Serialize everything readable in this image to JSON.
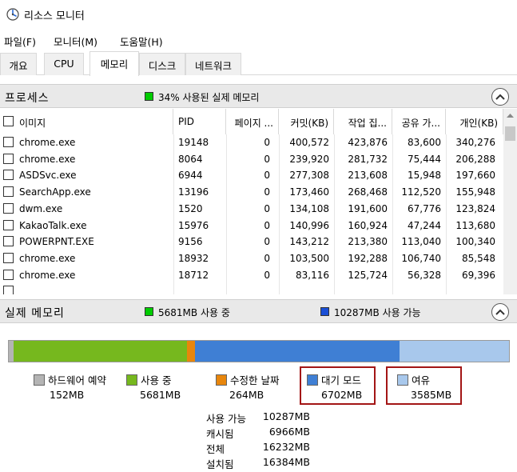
{
  "window": {
    "title": "리소스 모니터"
  },
  "menu": [
    "파일(F)",
    "모니터(M)",
    "도움말(H)"
  ],
  "tabs": [
    "개요",
    "CPU",
    "메모리",
    "디스크",
    "네트워크"
  ],
  "active_tab": "메모리",
  "process_section": {
    "title": "프로세스",
    "summary": "34% 사용된 실제 메모리",
    "summary_color": "#00cc00",
    "columns": [
      "이미지",
      "PID",
      "페이지 ...",
      "커밋(KB)",
      "작업 집...",
      "공유 가...",
      "개인(KB)"
    ],
    "rows": [
      {
        "image": "chrome.exe",
        "pid": "19148",
        "page": "0",
        "commit": "400,572",
        "working": "423,876",
        "shared": "83,600",
        "private": "340,276"
      },
      {
        "image": "chrome.exe",
        "pid": "8064",
        "page": "0",
        "commit": "239,920",
        "working": "281,732",
        "shared": "75,444",
        "private": "206,288"
      },
      {
        "image": "ASDSvc.exe",
        "pid": "6944",
        "page": "0",
        "commit": "277,308",
        "working": "213,608",
        "shared": "15,948",
        "private": "197,660"
      },
      {
        "image": "SearchApp.exe",
        "pid": "13196",
        "page": "0",
        "commit": "173,460",
        "working": "268,468",
        "shared": "112,520",
        "private": "155,948"
      },
      {
        "image": "dwm.exe",
        "pid": "1520",
        "page": "0",
        "commit": "134,108",
        "working": "191,600",
        "shared": "67,776",
        "private": "123,824"
      },
      {
        "image": "KakaoTalk.exe",
        "pid": "15976",
        "page": "0",
        "commit": "140,996",
        "working": "160,924",
        "shared": "47,244",
        "private": "113,680"
      },
      {
        "image": "POWERPNT.EXE",
        "pid": "9156",
        "page": "0",
        "commit": "143,212",
        "working": "213,380",
        "shared": "113,040",
        "private": "100,340"
      },
      {
        "image": "chrome.exe",
        "pid": "18932",
        "page": "0",
        "commit": "103,500",
        "working": "192,288",
        "shared": "106,740",
        "private": "85,548"
      },
      {
        "image": "chrome.exe",
        "pid": "18712",
        "page": "0",
        "commit": "83,116",
        "working": "125,724",
        "shared": "56,328",
        "private": "69,396"
      }
    ]
  },
  "memory_section": {
    "title": "실제 메모리",
    "in_use_summary": "5681MB 사용 중",
    "in_use_color": "#00cc00",
    "available_summary": "10287MB 사용 가능",
    "available_color": "#1a4fd6",
    "bar": [
      {
        "name": "hardware",
        "mb": 152,
        "color": "#b4b4b4"
      },
      {
        "name": "in_use",
        "mb": 5681,
        "color": "#76b81e"
      },
      {
        "name": "modified",
        "mb": 264,
        "color": "#e8860c"
      },
      {
        "name": "standby",
        "mb": 6702,
        "color": "#3f7fd4"
      },
      {
        "name": "free",
        "mb": 3585,
        "color": "#a8c8ec"
      }
    ],
    "legend": [
      {
        "label": "하드웨어 예약",
        "value": "152MB",
        "color": "#b4b4b4"
      },
      {
        "label": "사용 중",
        "value": "5681MB",
        "color": "#76b81e"
      },
      {
        "label": "수정한 날짜",
        "value": "264MB",
        "color": "#e8860c"
      },
      {
        "label": "대기 모드",
        "value": "6702MB",
        "color": "#3f7fd4"
      },
      {
        "label": "여유",
        "value": "3585MB",
        "color": "#a8c8ec"
      }
    ],
    "stats": [
      {
        "label": "사용 가능",
        "value": "10287MB"
      },
      {
        "label": "캐시됨",
        "value": "6966MB"
      },
      {
        "label": "전체",
        "value": "16232MB"
      },
      {
        "label": "설치됨",
        "value": "16384MB"
      }
    ]
  },
  "highlight_color": "#a31515"
}
